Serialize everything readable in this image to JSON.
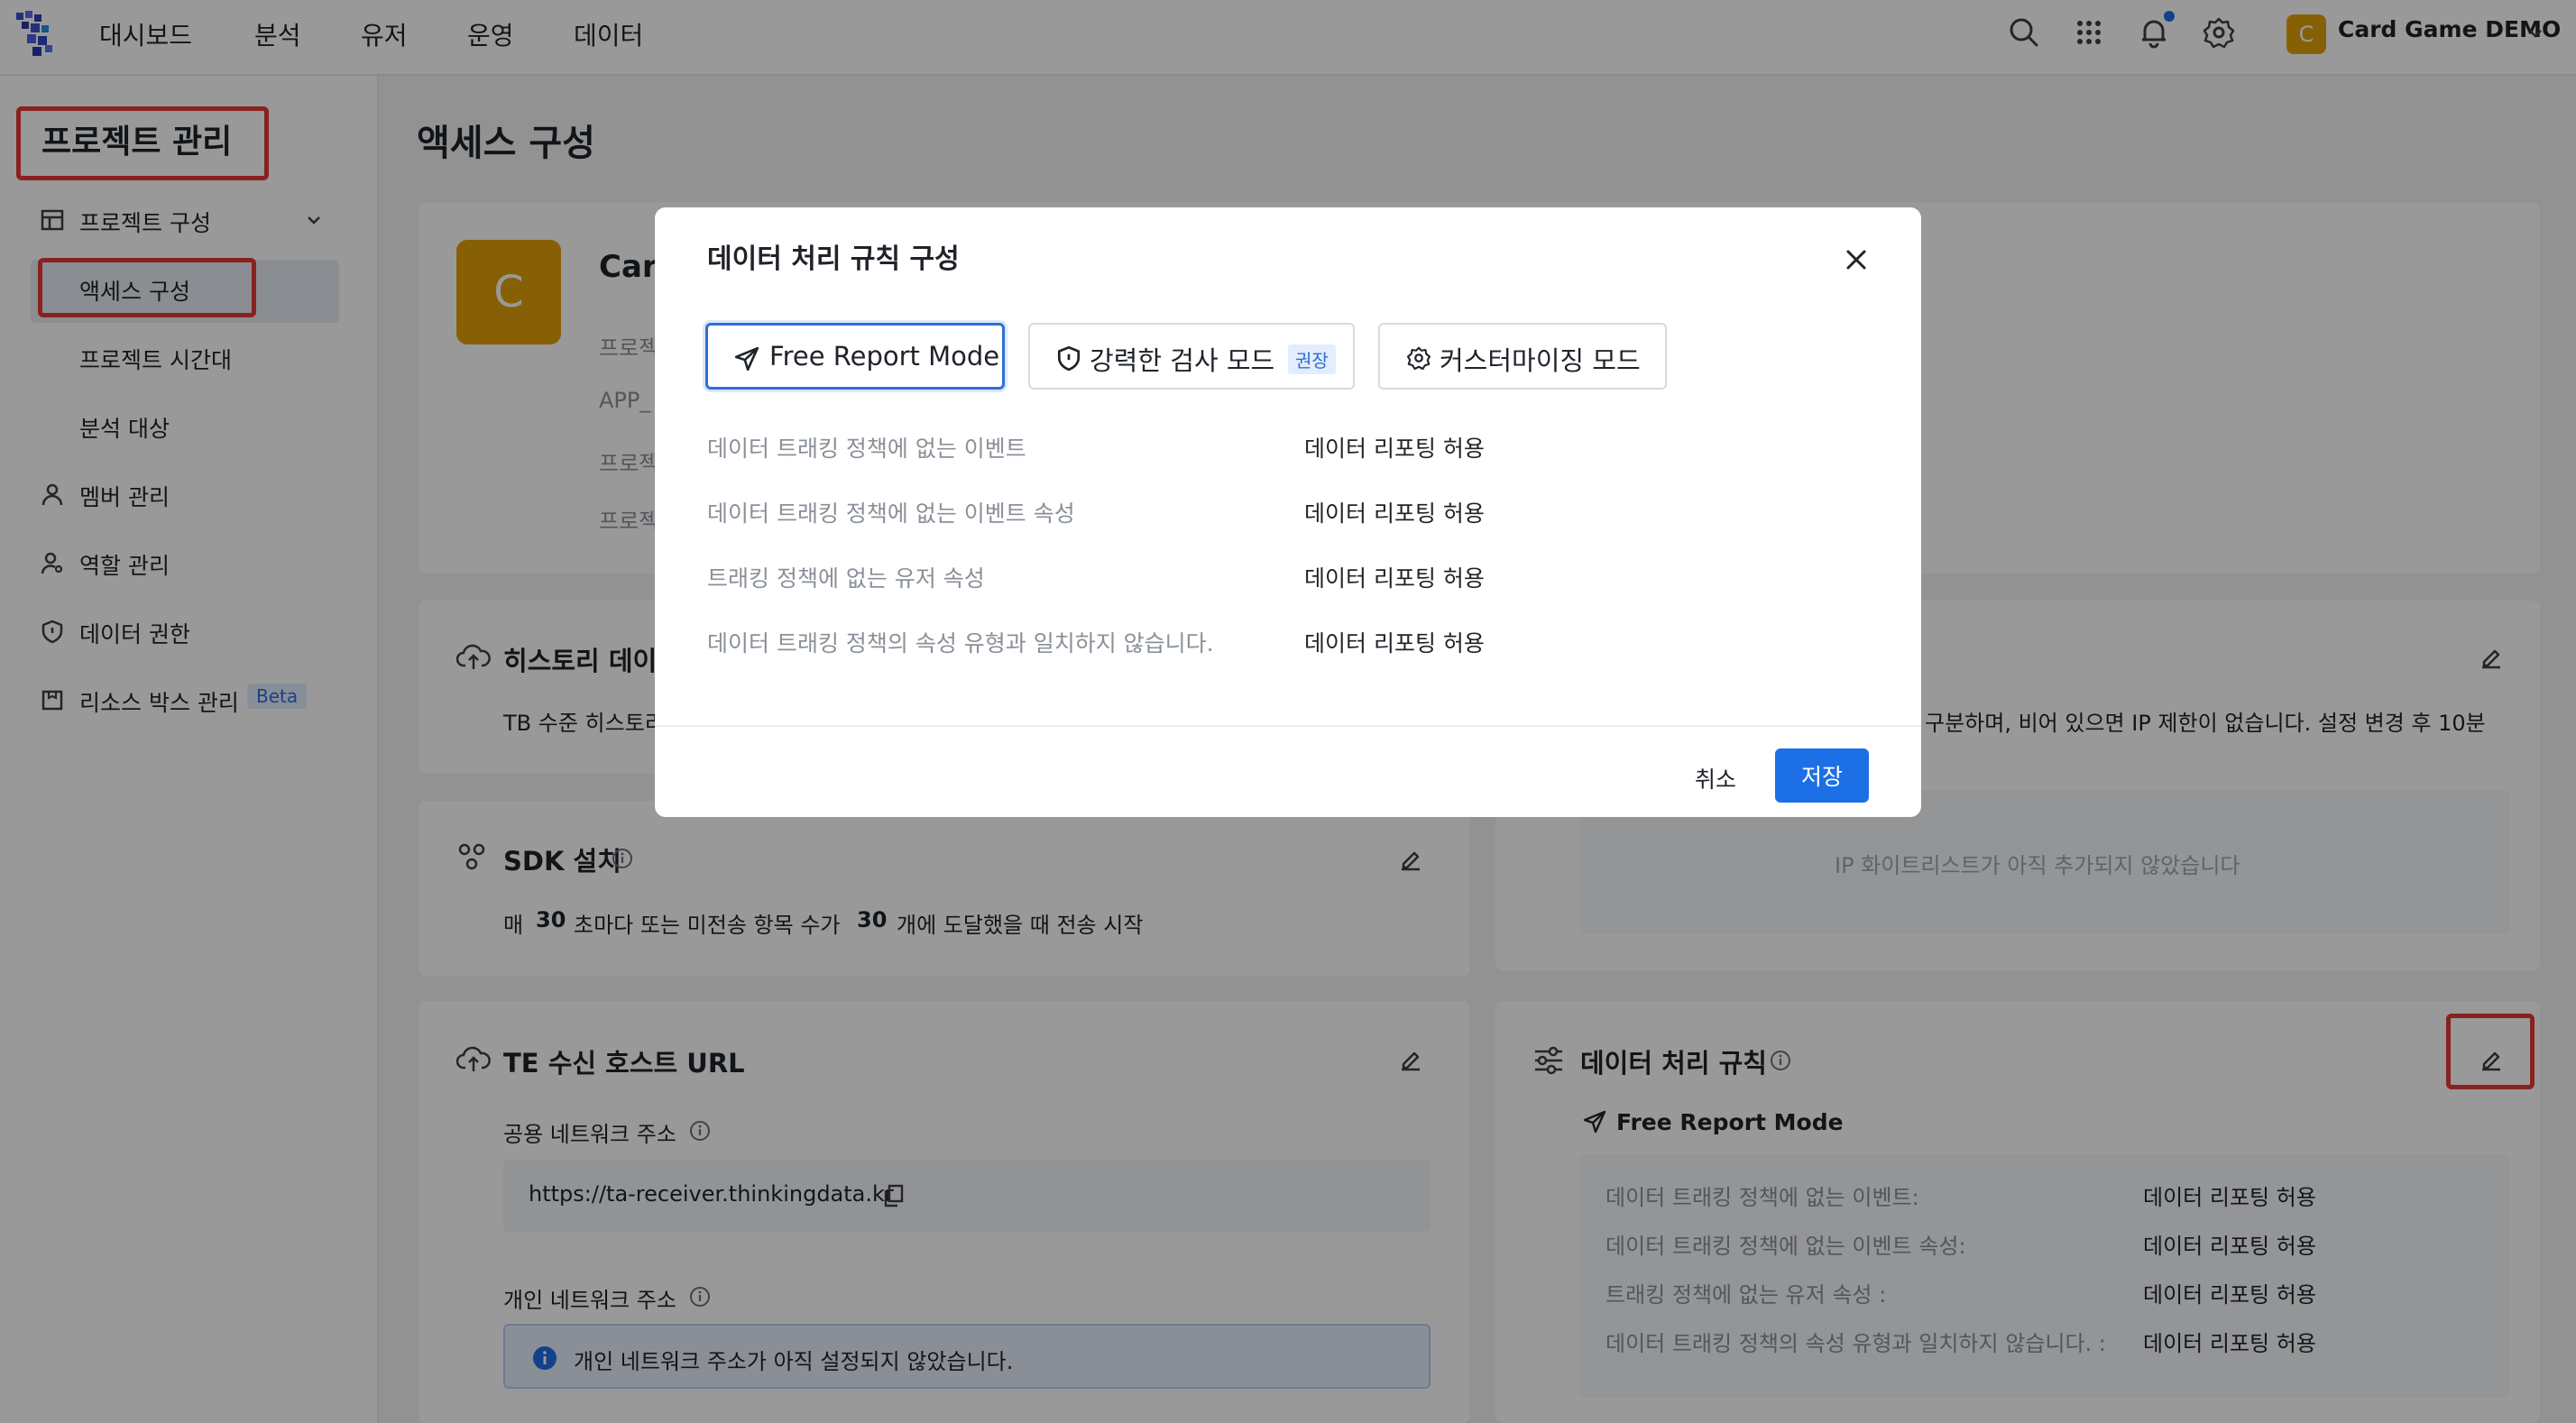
{
  "topnav": {
    "menu": [
      "대시보드",
      "분석",
      "유저",
      "운영",
      "데이터"
    ],
    "project": {
      "avatar_letter": "C",
      "name": "Card Game DEMO"
    },
    "icons": [
      "search-icon",
      "apps-grid-icon",
      "bell-icon",
      "gear-icon"
    ]
  },
  "sidebar": {
    "title": "프로젝트 관리",
    "group_label": "프로젝트 구성",
    "items": [
      {
        "label": "액세스 구성",
        "active": true
      },
      {
        "label": "프로젝트 시간대"
      },
      {
        "label": "분석 대상"
      },
      {
        "label": "멤버 관리",
        "icon": "user-icon"
      },
      {
        "label": "역할 관리",
        "icon": "role-icon"
      },
      {
        "label": "데이터 권한",
        "icon": "shield-icon"
      },
      {
        "label": "리소스 박스 관리",
        "icon": "box-icon",
        "badge": "Beta"
      }
    ]
  },
  "main": {
    "title": "액세스 구성",
    "project_card": {
      "avatar_letter": "C",
      "name_partial": "Car",
      "field_labels_partial": [
        "프로젝",
        "APP_",
        "프로젝",
        "프로젝"
      ]
    },
    "history_card": {
      "title_partial": "히스토리 데이",
      "text_partial": "TB 수준 히스토리"
    },
    "ip_card": {
      "text_partial": "구분하며, 비어 있으면 IP 제한이 없습니다. 설정 변경 후 10분",
      "empty_text": "IP 화이트리스트가 아직 추가되지 않았습니다"
    },
    "sdk_card": {
      "title": "SDK 설치",
      "text": {
        "prefix": "매",
        "seconds": "30",
        "middle": "초마다 또는 미전송 항목 수가",
        "count": "30",
        "suffix": "개에 도달했을 때 전송 시작"
      }
    },
    "te_card": {
      "title": "TE 수신 호스트 URL",
      "public_label": "공용 네트워크 주소",
      "public_url": "https://ta-receiver.thinkingdata.kr",
      "private_label": "개인 네트워크 주소",
      "private_alert": "개인 네트워크 주소가 아직 설정되지 않았습니다."
    },
    "rules_card": {
      "title": "데이터 처리 규칙",
      "mode": "Free Report Mode",
      "rows": [
        {
          "label": "데이터 트래킹 정책에 없는 이벤트:",
          "value": "데이터 리포팅 허용"
        },
        {
          "label": "데이터 트래킹 정책에 없는 이벤트 속성:",
          "value": "데이터 리포팅 허용"
        },
        {
          "label": "트래킹 정책에 없는 유저 속성 :",
          "value": "데이터 리포팅 허용"
        },
        {
          "label": "데이터 트래킹 정책의 속성 유형과 일치하지 않습니다. :",
          "value": "데이터 리포팅 허용"
        }
      ]
    }
  },
  "modal": {
    "title": "데이터 처리 규칙 구성",
    "modes": [
      {
        "label": "Free Report Mode",
        "icon": "send-icon",
        "selected": true
      },
      {
        "label": "강력한 검사 모드",
        "icon": "shield-icon",
        "tag": "권장"
      },
      {
        "label": "커스터마이징 모드",
        "icon": "gear-icon"
      }
    ],
    "rules": [
      {
        "label": "데이터 트래킹 정책에 없는 이벤트",
        "value": "데이터 리포팅 허용"
      },
      {
        "label": "데이터 트래킹 정책에 없는 이벤트 속성",
        "value": "데이터 리포팅 허용"
      },
      {
        "label": "트래킹 정책에 없는 유저 속성",
        "value": "데이터 리포팅 허용"
      },
      {
        "label": "데이터 트래킹 정책의 속성 유형과 일치하지 않습니다.",
        "value": "데이터 리포팅 허용"
      }
    ],
    "cancel_label": "취소",
    "save_label": "저장"
  },
  "colors": {
    "accent": "#1d6fe6",
    "highlight": "#e53935",
    "project_avatar": "#e2a10a"
  }
}
